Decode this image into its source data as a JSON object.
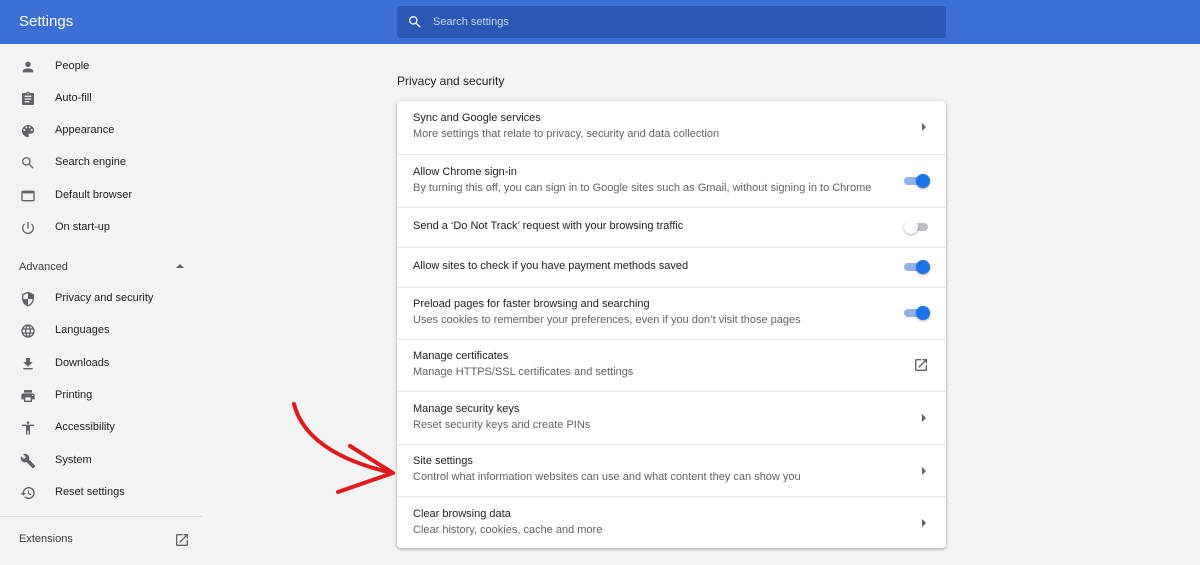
{
  "header": {
    "title": "Settings",
    "search_placeholder": "Search settings"
  },
  "sidebar": {
    "items": [
      {
        "label": "People",
        "icon": "person-icon"
      },
      {
        "label": "Auto-fill",
        "icon": "clipboard-icon"
      },
      {
        "label": "Appearance",
        "icon": "palette-icon"
      },
      {
        "label": "Search engine",
        "icon": "search-icon"
      },
      {
        "label": "Default browser",
        "icon": "browser-icon"
      },
      {
        "label": "On start-up",
        "icon": "power-icon"
      }
    ],
    "advanced_label": "Advanced",
    "advanced_items": [
      {
        "label": "Privacy and security",
        "icon": "shield-icon"
      },
      {
        "label": "Languages",
        "icon": "globe-icon"
      },
      {
        "label": "Downloads",
        "icon": "download-icon"
      },
      {
        "label": "Printing",
        "icon": "printer-icon"
      },
      {
        "label": "Accessibility",
        "icon": "accessibility-icon"
      },
      {
        "label": "System",
        "icon": "wrench-icon"
      },
      {
        "label": "Reset settings",
        "icon": "restore-icon"
      }
    ],
    "extensions_label": "Extensions"
  },
  "main": {
    "section_title": "Privacy and security",
    "rows": [
      {
        "title": "Sync and Google services",
        "subtitle": "More settings that relate to privacy, security and data collection",
        "control": "arrow"
      },
      {
        "title": "Allow Chrome sign-in",
        "subtitle": "By turning this off, you can sign in to Google sites such as Gmail, without signing in to Chrome",
        "control": "toggle",
        "on": true
      },
      {
        "title": "Send a ‘Do Not Track’ request with your browsing traffic",
        "control": "toggle",
        "on": false
      },
      {
        "title": "Allow sites to check if you have payment methods saved",
        "control": "toggle",
        "on": true
      },
      {
        "title": "Preload pages for faster browsing and searching",
        "subtitle": "Uses cookies to remember your preferences, even if you don’t visit those pages",
        "control": "toggle",
        "on": true
      },
      {
        "title": "Manage certificates",
        "subtitle": "Manage HTTPS/SSL certificates and settings",
        "control": "external-link"
      },
      {
        "title": "Manage security keys",
        "subtitle": "Reset security keys and create PINs",
        "control": "arrow"
      },
      {
        "title": "Site settings",
        "subtitle": "Control what information websites can use and what content they can show you",
        "control": "arrow"
      },
      {
        "title": "Clear browsing data",
        "subtitle": "Clear history, cookies, cache and more",
        "control": "arrow"
      }
    ]
  },
  "colors": {
    "header": "#3b6fd4",
    "toggle_on": "#1a73e8",
    "annotation_arrow": "#e0191c"
  }
}
